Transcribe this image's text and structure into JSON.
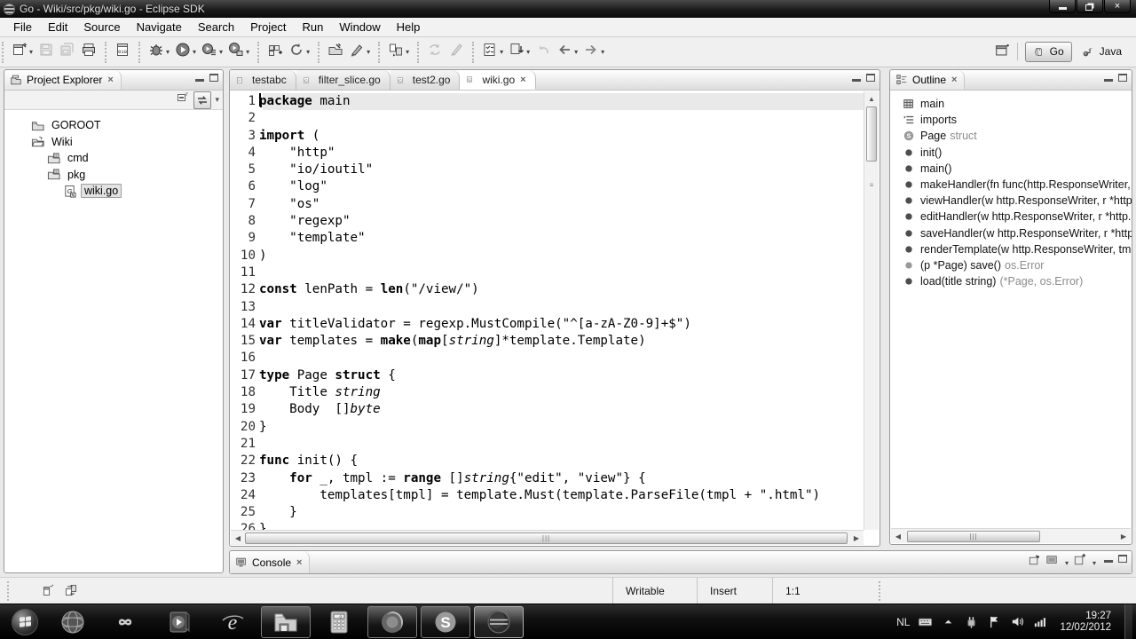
{
  "window": {
    "title": "Go - Wiki/src/pkg/wiki.go - Eclipse SDK"
  },
  "menu": [
    "File",
    "Edit",
    "Source",
    "Navigate",
    "Search",
    "Project",
    "Run",
    "Window",
    "Help"
  ],
  "toolbar": {
    "groups": [
      {
        "items": [
          {
            "icon": "new-wizard",
            "dropdown": true
          },
          {
            "icon": "save",
            "disabled": true
          },
          {
            "icon": "save-all",
            "disabled": true
          },
          {
            "icon": "print"
          }
        ]
      },
      {
        "items": [
          {
            "icon": "binary"
          }
        ]
      },
      {
        "items": [
          {
            "icon": "debug",
            "dropdown": true
          },
          {
            "icon": "run",
            "dropdown": true
          },
          {
            "icon": "run-history",
            "dropdown": true
          },
          {
            "icon": "run-external",
            "dropdown": true
          }
        ]
      },
      {
        "items": [
          {
            "icon": "new-project"
          },
          {
            "icon": "refresh",
            "dropdown": true
          }
        ]
      },
      {
        "items": [
          {
            "icon": "open-resource"
          },
          {
            "icon": "highlighter",
            "dropdown": true
          }
        ]
      },
      {
        "items": [
          {
            "icon": "toggle-pair",
            "dropdown": true
          }
        ]
      },
      {
        "items": [
          {
            "icon": "sync",
            "disabled": true
          },
          {
            "icon": "format-brush",
            "disabled": true
          }
        ]
      },
      {
        "items": [
          {
            "icon": "checklist",
            "dropdown": true
          },
          {
            "icon": "annotation-next",
            "dropdown": true
          },
          {
            "icon": "back-curved",
            "disabled": true
          },
          {
            "icon": "nav-back",
            "dropdown": true
          },
          {
            "icon": "nav-forward",
            "dropdown": true
          }
        ]
      }
    ]
  },
  "perspectives": {
    "buttons": [
      {
        "label": "Go",
        "icon": "go-tag",
        "active": true
      },
      {
        "label": "Java",
        "icon": "java",
        "active": false
      }
    ]
  },
  "project_explorer": {
    "title": "Project Explorer",
    "tree": [
      {
        "label": "GOROOT",
        "icon": "folder-closed",
        "indent": 0,
        "selected": false
      },
      {
        "label": "Wiki",
        "icon": "folder-open",
        "indent": 0,
        "selected": false
      },
      {
        "label": "cmd",
        "icon": "folder-pkg",
        "indent": 1,
        "selected": false
      },
      {
        "label": "pkg",
        "icon": "folder-pkg",
        "indent": 1,
        "selected": false
      },
      {
        "label": "wiki.go",
        "icon": "go-file",
        "indent": 2,
        "selected": true
      }
    ]
  },
  "editor": {
    "tabs": [
      {
        "label": "testabc",
        "icon": "doc",
        "active": false,
        "closable": false
      },
      {
        "label": "filter_slice.go",
        "icon": "go",
        "active": false,
        "closable": false
      },
      {
        "label": "test2.go",
        "icon": "go",
        "active": false,
        "closable": false
      },
      {
        "label": "wiki.go",
        "icon": "go",
        "active": true,
        "closable": true
      }
    ],
    "close_glyph": "×",
    "current_line": 1,
    "lines": [
      {
        "n": 1,
        "segs": [
          {
            "t": "package",
            "s": "b"
          },
          {
            "t": " main",
            "s": ""
          }
        ]
      },
      {
        "n": 2,
        "segs": []
      },
      {
        "n": 3,
        "segs": [
          {
            "t": "import",
            "s": "b"
          },
          {
            "t": " (",
            "s": ""
          }
        ]
      },
      {
        "n": 4,
        "segs": [
          {
            "t": "    \"http\"",
            "s": ""
          }
        ]
      },
      {
        "n": 5,
        "segs": [
          {
            "t": "    \"io/ioutil\"",
            "s": ""
          }
        ]
      },
      {
        "n": 6,
        "segs": [
          {
            "t": "    \"log\"",
            "s": ""
          }
        ]
      },
      {
        "n": 7,
        "segs": [
          {
            "t": "    \"os\"",
            "s": ""
          }
        ]
      },
      {
        "n": 8,
        "segs": [
          {
            "t": "    \"regexp\"",
            "s": ""
          }
        ]
      },
      {
        "n": 9,
        "segs": [
          {
            "t": "    \"template\"",
            "s": ""
          }
        ]
      },
      {
        "n": 10,
        "segs": [
          {
            "t": ")",
            "s": ""
          }
        ]
      },
      {
        "n": 11,
        "segs": []
      },
      {
        "n": 12,
        "segs": [
          {
            "t": "const",
            "s": "b"
          },
          {
            "t": " lenPath = ",
            "s": ""
          },
          {
            "t": "len",
            "s": "b"
          },
          {
            "t": "(\"/view/\")",
            "s": ""
          }
        ]
      },
      {
        "n": 13,
        "segs": []
      },
      {
        "n": 14,
        "segs": [
          {
            "t": "var",
            "s": "b"
          },
          {
            "t": " titleValidator = regexp.MustCompile(\"^[a-zA-Z0-9]+$\")",
            "s": ""
          }
        ]
      },
      {
        "n": 15,
        "segs": [
          {
            "t": "var",
            "s": "b"
          },
          {
            "t": " templates = ",
            "s": ""
          },
          {
            "t": "make",
            "s": "b"
          },
          {
            "t": "(",
            "s": ""
          },
          {
            "t": "map",
            "s": "b"
          },
          {
            "t": "[",
            "s": ""
          },
          {
            "t": "string",
            "s": "i"
          },
          {
            "t": "]*template.Template)",
            "s": ""
          }
        ]
      },
      {
        "n": 16,
        "segs": []
      },
      {
        "n": 17,
        "segs": [
          {
            "t": "type",
            "s": "b"
          },
          {
            "t": " Page ",
            "s": ""
          },
          {
            "t": "struct",
            "s": "b"
          },
          {
            "t": " {",
            "s": ""
          }
        ]
      },
      {
        "n": 18,
        "segs": [
          {
            "t": "    Title ",
            "s": ""
          },
          {
            "t": "string",
            "s": "i"
          }
        ]
      },
      {
        "n": 19,
        "segs": [
          {
            "t": "    Body  []",
            "s": ""
          },
          {
            "t": "byte",
            "s": "i"
          }
        ]
      },
      {
        "n": 20,
        "segs": [
          {
            "t": "}",
            "s": ""
          }
        ]
      },
      {
        "n": 21,
        "segs": []
      },
      {
        "n": 22,
        "segs": [
          {
            "t": "func",
            "s": "b"
          },
          {
            "t": " init() {",
            "s": ""
          }
        ]
      },
      {
        "n": 23,
        "segs": [
          {
            "t": "    ",
            "s": ""
          },
          {
            "t": "for",
            "s": "b"
          },
          {
            "t": " _, tmpl := ",
            "s": ""
          },
          {
            "t": "range",
            "s": "b"
          },
          {
            "t": " []",
            "s": ""
          },
          {
            "t": "string",
            "s": "i"
          },
          {
            "t": "{\"edit\", \"view\"} {",
            "s": ""
          }
        ]
      },
      {
        "n": 24,
        "segs": [
          {
            "t": "        templates[tmpl] = template.Must(template.ParseFile(tmpl + \".html\")",
            "s": ""
          }
        ]
      },
      {
        "n": 25,
        "segs": [
          {
            "t": "    }",
            "s": ""
          }
        ]
      },
      {
        "n": 26,
        "segs": [
          {
            "t": "}",
            "s": ""
          }
        ]
      }
    ]
  },
  "outline": {
    "title": "Outline",
    "items": [
      {
        "icon": "package",
        "label": "main",
        "suffix": ""
      },
      {
        "icon": "imports",
        "label": "imports",
        "suffix": ""
      },
      {
        "icon": "struct",
        "label": "Page",
        "suffix": "struct"
      },
      {
        "icon": "method",
        "label": "init()",
        "suffix": ""
      },
      {
        "icon": "method",
        "label": "main()",
        "suffix": ""
      },
      {
        "icon": "method",
        "label": "makeHandler(fn func(http.ResponseWriter,",
        "suffix": ""
      },
      {
        "icon": "method",
        "label": "viewHandler(w http.ResponseWriter, r *http.",
        "suffix": ""
      },
      {
        "icon": "method",
        "label": "editHandler(w http.ResponseWriter, r *http.F",
        "suffix": ""
      },
      {
        "icon": "method",
        "label": "saveHandler(w http.ResponseWriter, r *http.",
        "suffix": ""
      },
      {
        "icon": "method",
        "label": "renderTemplate(w http.ResponseWriter, tmp",
        "suffix": ""
      },
      {
        "icon": "method-light",
        "label": "(p *Page) save()",
        "suffix": "os.Error"
      },
      {
        "icon": "method",
        "label": "load(title string)",
        "suffix": "(*Page, os.Error)"
      }
    ]
  },
  "console": {
    "title": "Console"
  },
  "status": {
    "items": [
      "Writable",
      "Insert",
      "1:1"
    ]
  },
  "taskbar": {
    "apps": [
      {
        "name": "start-button",
        "icon": "start",
        "active": false
      },
      {
        "name": "app-globe",
        "icon": "globe",
        "active": false
      },
      {
        "name": "app-infinity",
        "icon": "infinity",
        "active": false
      },
      {
        "name": "app-media-player",
        "icon": "media-player",
        "active": false
      },
      {
        "name": "app-internet-explorer",
        "icon": "ie",
        "active": false
      },
      {
        "name": "app-explorer",
        "icon": "explorer",
        "active": true
      },
      {
        "name": "app-calculator",
        "icon": "calculator",
        "active": false
      },
      {
        "name": "app-firefox",
        "icon": "firefox",
        "active": true
      },
      {
        "name": "app-skype",
        "icon": "skype",
        "active": true
      },
      {
        "name": "app-eclipse",
        "icon": "eclipse",
        "active": true,
        "focused": true
      }
    ],
    "lang": "NL",
    "tray_icons": [
      "keyboard",
      "tray-arrow",
      "power",
      "flag",
      "volume",
      "network"
    ],
    "clock": {
      "time": "19:27",
      "date": "12/02/2012"
    }
  }
}
